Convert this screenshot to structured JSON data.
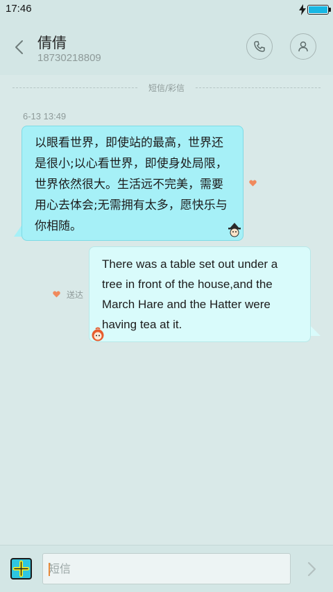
{
  "status_bar": {
    "time": "17:46",
    "battery_level_pct": 100,
    "charging": true
  },
  "header": {
    "contact_name": "倩倩",
    "contact_number": "18730218809"
  },
  "chat": {
    "divider_label": "短信/彩信",
    "messages": [
      {
        "direction": "incoming",
        "timestamp": "6-13 13:49",
        "lines": [
          "以眼看世界，即使站的最高，世界还",
          "是很小;以心看世界，即使身处局限，",
          "世界依然很大。生活远不完美，需要",
          "用心去体会;无需拥有太多，愿快乐与",
          "你相随。"
        ]
      },
      {
        "direction": "outgoing",
        "status": "送达",
        "lines": [
          "There was a table set out under a",
          "tree in front of the house,and the",
          "March Hare and the Hatter were",
          "having tea at it."
        ]
      }
    ]
  },
  "composer": {
    "placeholder": "短信"
  },
  "icons": {
    "back": "chevron-left-icon",
    "call": "phone-icon",
    "profile": "person-icon",
    "add": "plus-icon",
    "send": "chevron-right-icon",
    "heart": "heart-icon"
  },
  "colors": {
    "background": "#d9e9e8",
    "incoming_bubble": "#a6f0f7",
    "outgoing_bubble": "#d9fbfb",
    "accent_heart": "#f08a5d",
    "battery": "#18b7e3"
  }
}
